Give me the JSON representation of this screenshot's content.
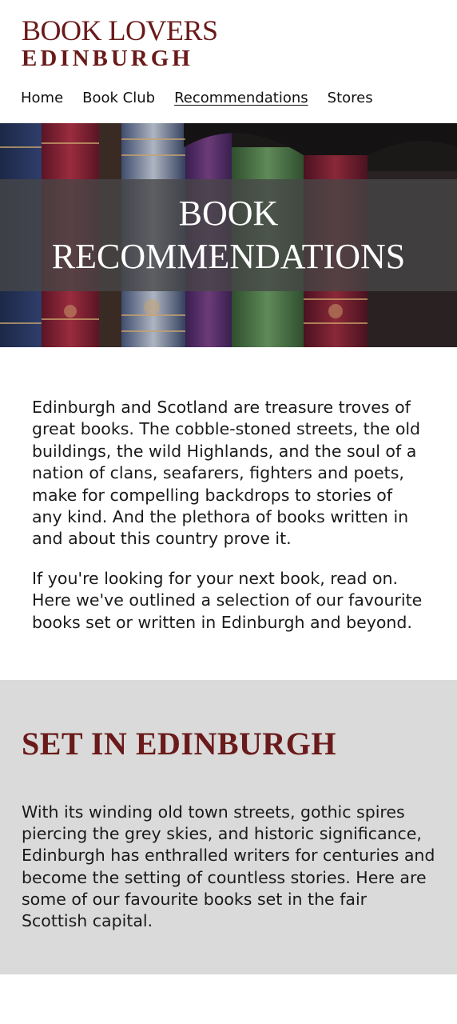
{
  "brand": {
    "line1": "BOOK LOVERS",
    "line2": "EDINBURGH"
  },
  "nav": {
    "items": [
      {
        "label": "Home"
      },
      {
        "label": "Book Club"
      },
      {
        "label": "Recommendations"
      },
      {
        "label": "Stores"
      }
    ],
    "active_label": "Recommendations"
  },
  "hero": {
    "title_line1": "BOOK",
    "title_line2": "RECOMMENDATIONS"
  },
  "intro": {
    "paragraph1": "Edinburgh and Scotland are treasure troves of great books. The cobble-stoned streets, the old buildings, the wild Highlands, and the soul of a nation of clans, seafarers, fighters and poets, make for compelling backdrops to stories of any kind. And the plethora of books written in and about this country prove it.",
    "paragraph2": "If you're looking for your next book, read on. Here we've outlined a selection of our favourite books set or written in Edinburgh and beyond."
  },
  "set_in_edinburgh": {
    "heading": "SET IN EDINBURGH",
    "body": "With its winding old town streets, gothic spires piercing the grey skies, and historic significance, Edinburgh has enthralled writers for centuries and become the setting of countless stories. Here are some of our favourite books set in the fair Scottish capital."
  },
  "colors": {
    "brand": "#6a1a1a",
    "section_bg": "#dadada",
    "hero_overlay": "#464646"
  }
}
